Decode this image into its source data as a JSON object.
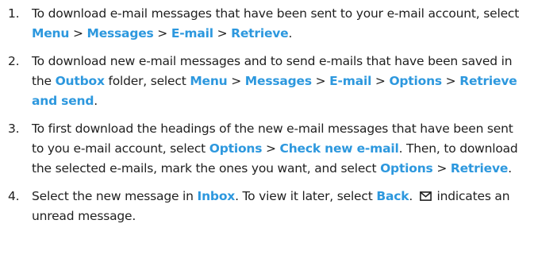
{
  "steps": [
    {
      "number": "1.",
      "text_before": "To download e-mail messages that have been sent to your e-mail account, select ",
      "path": [
        "Menu",
        "Messages",
        "E-mail",
        "Retrieve"
      ],
      "text_after": "."
    },
    {
      "number": "2.",
      "text_before": "To download new e-mail messages and to send e-mails that have been saved in the ",
      "folder": "Outbox",
      "text_mid": " folder, select ",
      "path": [
        "Menu",
        "Messages",
        "E-mail",
        "Options",
        "Retrieve and send"
      ],
      "text_after": "."
    },
    {
      "number": "3.",
      "text_before": "To first download the headings of the new e-mail messages that have been sent to you e-mail account, select ",
      "path1": [
        "Options",
        "Check new e-mail"
      ],
      "text_mid": ". Then, to download the selected e-mails, mark the ones you want, and select ",
      "path2": [
        "Options",
        "Retrieve"
      ],
      "text_after": "."
    },
    {
      "number": "4.",
      "text_before": "Select the new message in ",
      "folder": "Inbox",
      "text_mid": ". To view it later, select ",
      "action": "Back",
      "text_mid2": ". ",
      "icon": "envelope-icon",
      "text_after": " indicates an unread message."
    }
  ],
  "separator": " > ",
  "colors": {
    "highlight": "#2d98de",
    "text": "#1f1f1f"
  }
}
